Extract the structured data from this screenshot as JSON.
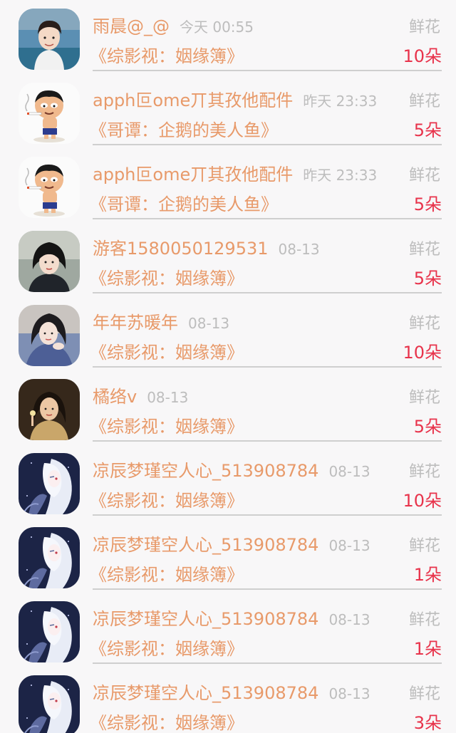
{
  "records": [
    {
      "user": "雨晨@_@",
      "time": "今天 00:55",
      "gift": "鲜花",
      "book": "《综影视：姻缘簿》",
      "count": "10朵",
      "avatar": "young-man"
    },
    {
      "user": "apph叵ome丌其孜他配件",
      "time": "昨天 23:33",
      "gift": "鲜花",
      "book": "《哥谭：企鹅的美人鱼》",
      "count": "5朵",
      "avatar": "cartoon-smoker"
    },
    {
      "user": "apph叵ome丌其孜他配件",
      "time": "昨天 23:33",
      "gift": "鲜花",
      "book": "《哥谭：企鹅的美人鱼》",
      "count": "5朵",
      "avatar": "cartoon-smoker"
    },
    {
      "user": "游客1580050129531",
      "time": "08-13",
      "gift": "鲜花",
      "book": "《综影视：姻缘簿》",
      "count": "5朵",
      "avatar": "woman-dark-hair"
    },
    {
      "user": "年年苏暖年",
      "time": "08-13",
      "gift": "鲜花",
      "book": "《综影视：姻缘簿》",
      "count": "10朵",
      "avatar": "woman-costume"
    },
    {
      "user": "橘络v",
      "time": "08-13",
      "gift": "鲜花",
      "book": "《综影视：姻缘簿》",
      "count": "5朵",
      "avatar": "woman-warm"
    },
    {
      "user": "凉辰梦瑾空人心_513908784",
      "time": "08-13",
      "gift": "鲜花",
      "book": "《综影视：姻缘簿》",
      "count": "10朵",
      "avatar": "anime-white-hair"
    },
    {
      "user": "凉辰梦瑾空人心_513908784",
      "time": "08-13",
      "gift": "鲜花",
      "book": "《综影视：姻缘簿》",
      "count": "1朵",
      "avatar": "anime-white-hair"
    },
    {
      "user": "凉辰梦瑾空人心_513908784",
      "time": "08-13",
      "gift": "鲜花",
      "book": "《综影视：姻缘簿》",
      "count": "1朵",
      "avatar": "anime-white-hair"
    },
    {
      "user": "凉辰梦瑾空人心_513908784",
      "time": "08-13",
      "gift": "鲜花",
      "book": "《综影视：姻缘簿》",
      "count": "3朵",
      "avatar": "anime-white-hair"
    }
  ],
  "colors": {
    "name": "#e89a6a",
    "muted": "#bdbdbd",
    "count": "#e8334b",
    "background": "#f8f7f8"
  }
}
